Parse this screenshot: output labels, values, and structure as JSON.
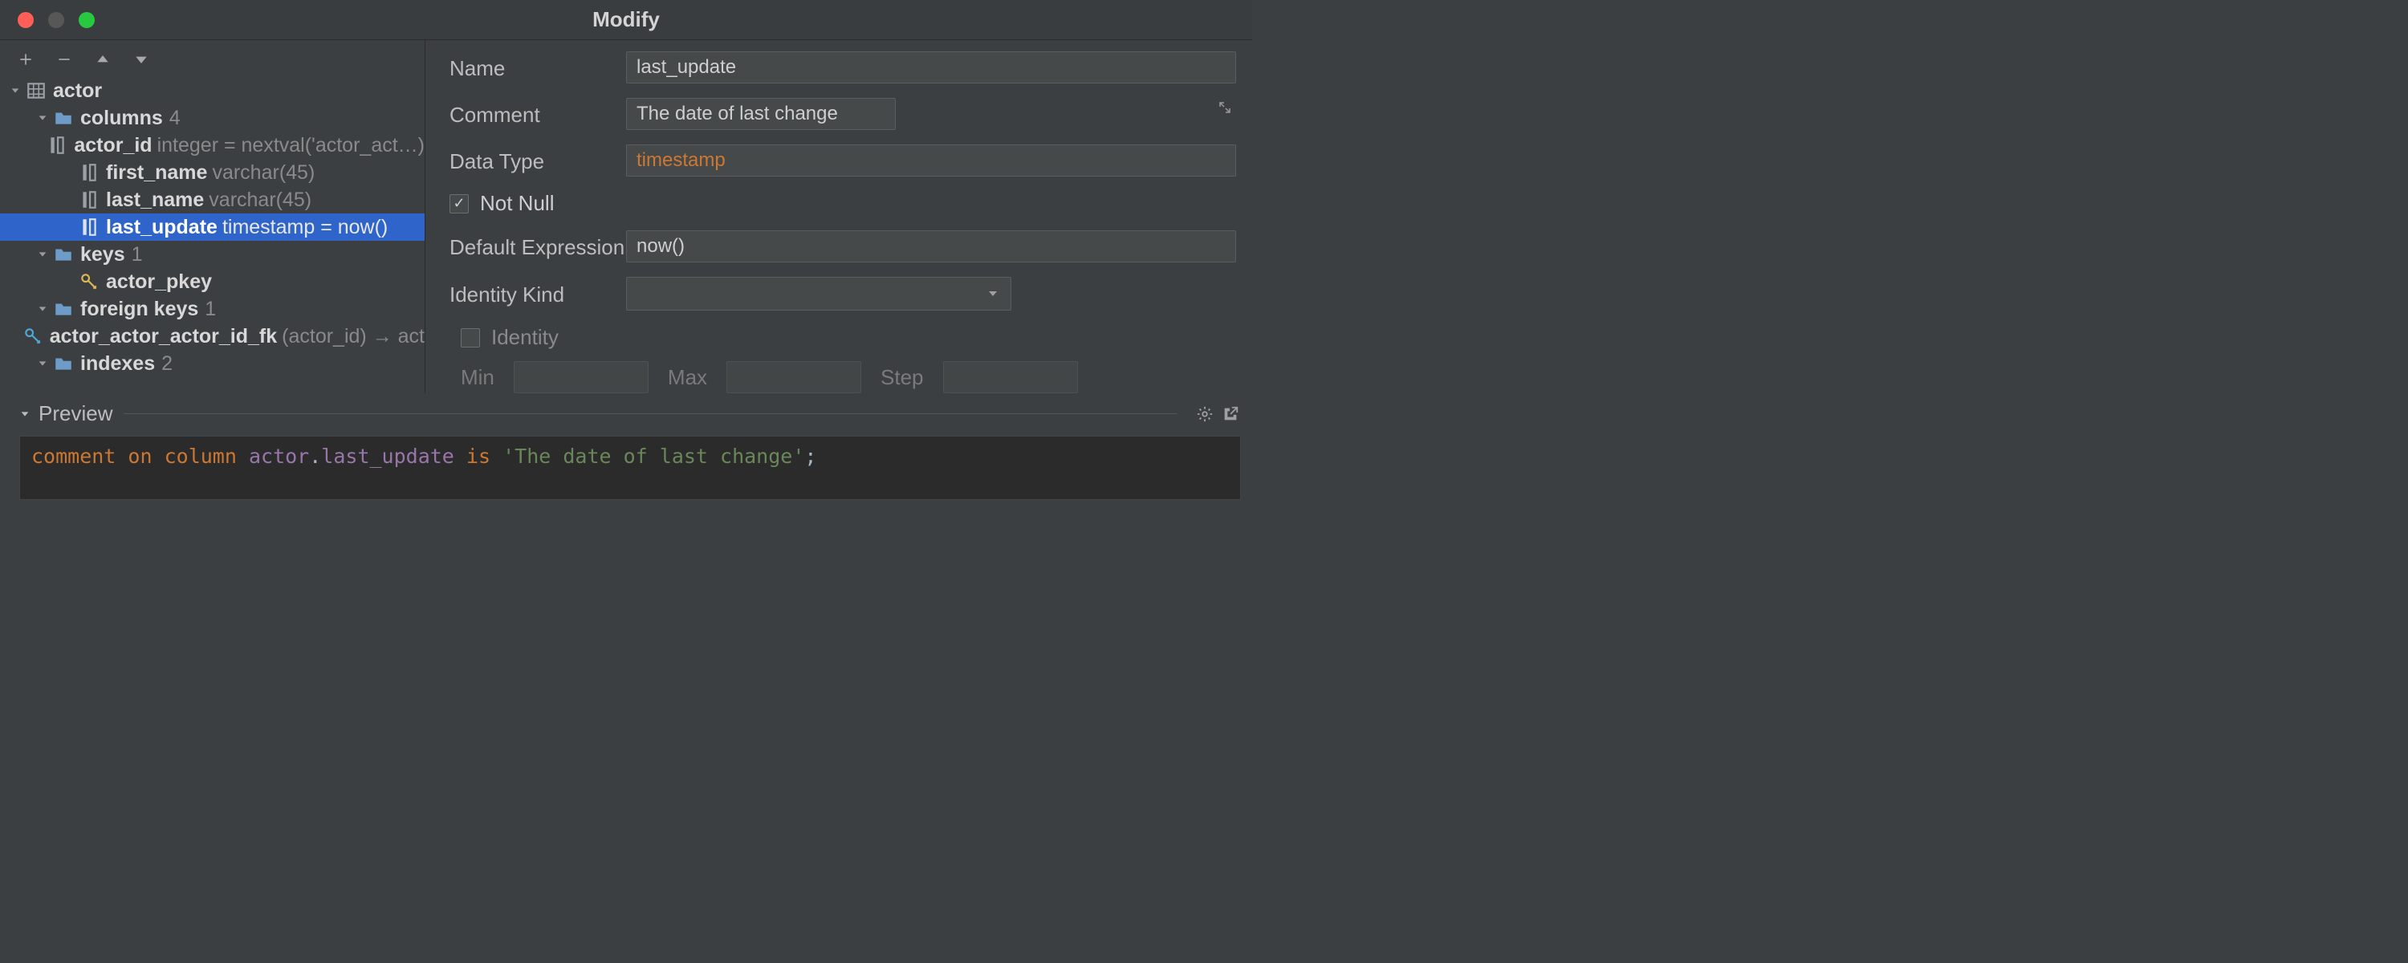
{
  "window": {
    "title": "Modify"
  },
  "toolbar": {
    "add": "+",
    "remove": "−"
  },
  "tree": {
    "root": {
      "label": "actor"
    },
    "columns": {
      "label": "columns",
      "count": "4"
    },
    "col0": {
      "name": "actor_id",
      "detail": "integer = nextval('actor_act…)"
    },
    "col1": {
      "name": "first_name",
      "detail": "varchar(45)"
    },
    "col2": {
      "name": "last_name",
      "detail": "varchar(45)"
    },
    "col3": {
      "name": "last_update",
      "detail": "timestamp = now()"
    },
    "keys": {
      "label": "keys",
      "count": "1"
    },
    "key0": {
      "name": "actor_pkey"
    },
    "fkeys": {
      "label": "foreign keys",
      "count": "1"
    },
    "fkey0": {
      "name": "actor_actor_actor_id_fk",
      "detail": "(actor_id) → act"
    },
    "indexes": {
      "label": "indexes",
      "count": "2"
    }
  },
  "form": {
    "name_label": "Name",
    "name_value": "last_update",
    "comment_label": "Comment",
    "comment_value": "The date of last change",
    "datatype_label": "Data Type",
    "datatype_value": "timestamp",
    "notnull_label": "Not Null",
    "default_label": "Default Expression",
    "default_value": "now()",
    "identitykind_label": "Identity Kind",
    "identity_label": "Identity",
    "min_label": "Min",
    "max_label": "Max",
    "step_label": "Step"
  },
  "preview": {
    "label": "Preview",
    "sql_kw1": "comment",
    "sql_kw2": "on",
    "sql_kw3": "column",
    "sql_ident_table": "actor",
    "sql_ident_col": "last_update",
    "sql_kw4": "is",
    "sql_str": "'The date of last change'",
    "sql_end": ";"
  }
}
